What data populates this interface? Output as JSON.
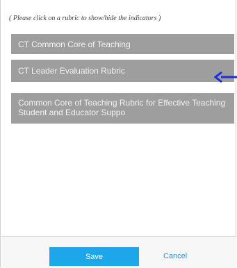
{
  "instruction": "( Please click on a rubric to show/hide the indicators )",
  "rubrics": [
    {
      "label": "CT Common Core of Teaching"
    },
    {
      "label": "CT Leader Evaluation Rubric"
    },
    {
      "label": "Common Core of Teaching Rubric for Effective Teaching Student and Educator Suppo"
    }
  ],
  "annotation": {
    "icon": "arrow-left-icon",
    "color": "#1b2fd6"
  },
  "footer": {
    "save_label": "Save",
    "cancel_label": "Cancel"
  },
  "colors": {
    "rubric_bg": "#9e9e9e",
    "rubric_text": "#f3f3f3",
    "save_bg": "#1ea6ea",
    "cancel_text": "#2a8fe0"
  }
}
